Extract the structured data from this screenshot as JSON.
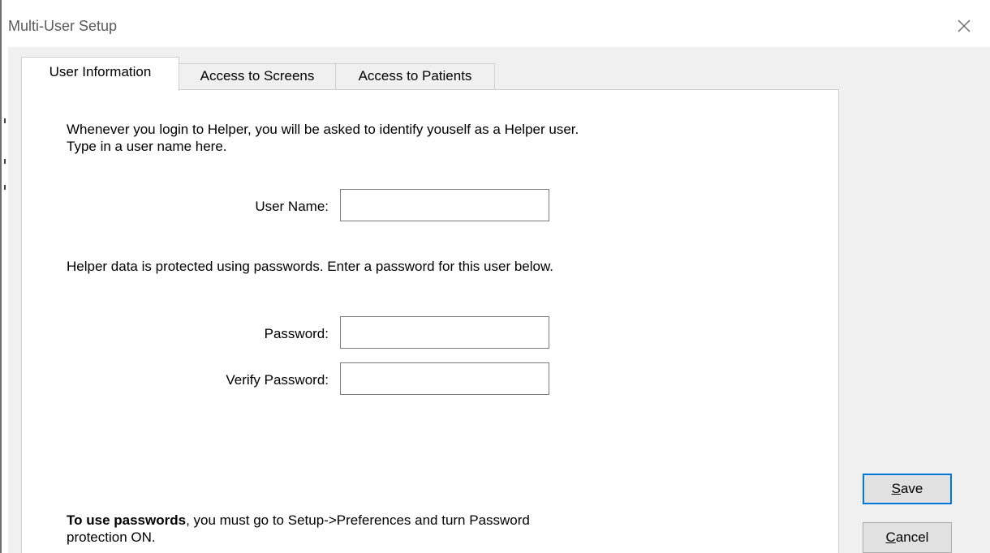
{
  "window": {
    "title": "Multi-User Setup",
    "close_icon": "close-icon"
  },
  "tabs": [
    {
      "label": "User Information",
      "active": true
    },
    {
      "label": "Access to Screens",
      "active": false
    },
    {
      "label": "Access to Patients",
      "active": false
    }
  ],
  "panel": {
    "intro_line1": "Whenever you login to Helper, you will be asked to identify youself as a Helper user.",
    "intro_line2": "Type in a user name here.",
    "user_name_label": "User Name:",
    "user_name_value": "",
    "password_intro": "Helper data is protected using passwords. Enter a password for this user below.",
    "password_label": "Password:",
    "password_value": "",
    "verify_password_label": "Verify Password:",
    "verify_password_value": "",
    "note_bold": "To use passwords",
    "note_rest_line1": ", you must go to Setup->Preferences and turn Password",
    "note_line2": "protection ON."
  },
  "buttons": {
    "save": {
      "mnemonic": "S",
      "rest": "ave"
    },
    "cancel": {
      "mnemonic": "C",
      "rest": "ancel"
    }
  },
  "colors": {
    "dialog_background": "#f0f0f0",
    "panel_background": "#ffffff",
    "default_button_border": "#0078d7"
  }
}
